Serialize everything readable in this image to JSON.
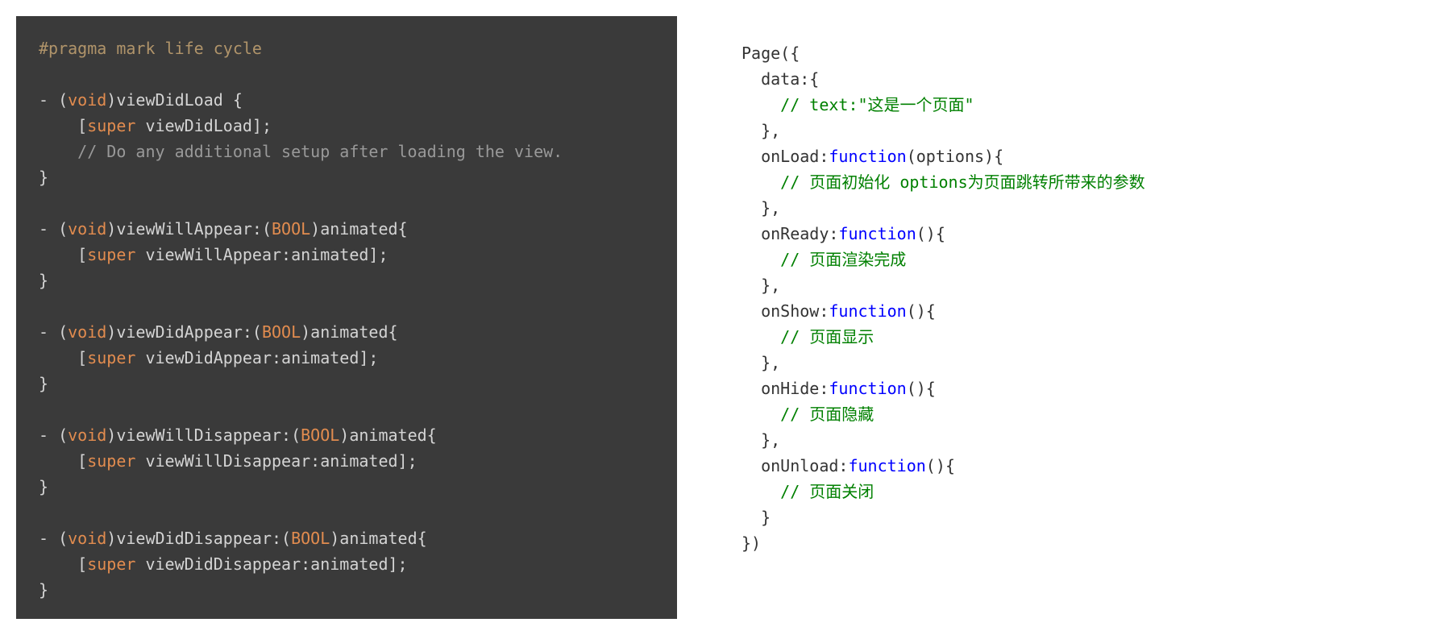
{
  "left": {
    "pragma": "#pragma mark life cycle",
    "methods": [
      {
        "signature_prefix": "- (",
        "void": "void",
        "signature_mid": ")viewDidLoad {",
        "body_prefix": "    [",
        "super": "super",
        "body_suffix": " viewDidLoad];",
        "comment": "    // Do any additional setup after loading the view.",
        "close": "}"
      },
      {
        "signature_prefix": "- (",
        "void": "void",
        "signature_mid": ")viewWillAppear:(",
        "bool": "BOOL",
        "signature_suffix": ")animated{",
        "body_prefix": "    [",
        "super": "super",
        "body_suffix": " viewWillAppear:animated];",
        "close": "}"
      },
      {
        "signature_prefix": "- (",
        "void": "void",
        "signature_mid": ")viewDidAppear:(",
        "bool": "BOOL",
        "signature_suffix": ")animated{",
        "body_prefix": "    [",
        "super": "super",
        "body_suffix": " viewDidAppear:animated];",
        "close": "}"
      },
      {
        "signature_prefix": "- (",
        "void": "void",
        "signature_mid": ")viewWillDisappear:(",
        "bool": "BOOL",
        "signature_suffix": ")animated{",
        "body_prefix": "    [",
        "super": "super",
        "body_suffix": " viewWillDisappear:animated];",
        "close": "}"
      },
      {
        "signature_prefix": "- (",
        "void": "void",
        "signature_mid": ")viewDidDisappear:(",
        "bool": "BOOL",
        "signature_suffix": ")animated{",
        "body_prefix": "    [",
        "super": "super",
        "body_suffix": " viewDidDisappear:animated];",
        "close": "}"
      }
    ]
  },
  "right": {
    "page_open": "Page({",
    "data_open": "  data:{",
    "data_comment": "    // text:\"这是一个页面\"",
    "data_close": "  },",
    "onload_line": "  onLoad:",
    "function_kw": "function",
    "onload_params": "(options){",
    "onload_comment": "    // 页面初始化 options为页面跳转所带来的参数",
    "block_close": "  },",
    "onready_line": "  onReady:",
    "onready_params": "(){",
    "onready_comment": "    // 页面渲染完成",
    "onshow_line": "  onShow:",
    "onshow_params": "(){",
    "onshow_comment": "    // 页面显示",
    "onhide_line": "  onHide:",
    "onhide_params": "(){",
    "onhide_comment": "    // 页面隐藏",
    "onunload_line": "  onUnload:",
    "onunload_params": "(){",
    "onunload_comment": "    // 页面关闭",
    "last_block_close": "  }",
    "page_close": "})"
  }
}
